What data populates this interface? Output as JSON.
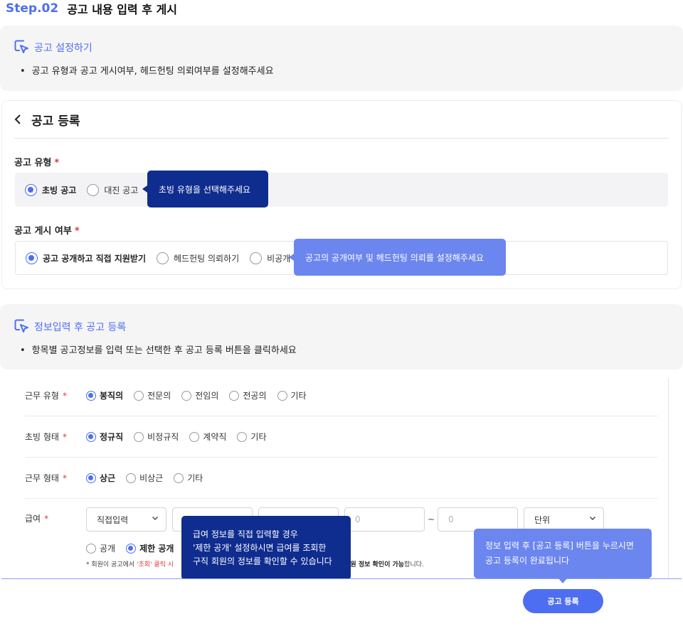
{
  "step": {
    "tag": "Step.02",
    "title": "공고 내용 입력 후 게시"
  },
  "guide1": {
    "title": "공고 설정하기",
    "desc": "공고 유형과 공고 게시여부, 헤드헌팅 의뢰여부를 설정해주세요"
  },
  "register": {
    "back_icon": "chevron-left-icon",
    "title": "공고 등록"
  },
  "job_type": {
    "label": "공고 유형",
    "required": "*",
    "options": [
      {
        "label": "초빙 공고",
        "selected": true
      },
      {
        "label": "대진 공고",
        "selected": false
      }
    ]
  },
  "tip_type": "초빙 유형을 선택해주세요",
  "publish": {
    "label": "공고 게시 여부",
    "required": "*",
    "options": [
      {
        "label": "공고 공개하고 직접 지원받기",
        "selected": true
      },
      {
        "label": "헤드헌팅 의뢰하기",
        "selected": false
      },
      {
        "label": "비공개",
        "selected": false
      }
    ]
  },
  "tip_publish": "공고의 공개여부 및 헤드헌팅 의뢰를 설정해주세요",
  "guide2": {
    "title": "정보입력 후 공고 등록",
    "desc": "항목별 공고정보를 입력 또는 선택한 후 공고 등록 버튼을 클릭하세요"
  },
  "form": {
    "rows": [
      {
        "label": "근무 유형",
        "required": "*",
        "options": [
          {
            "label": "봉직의",
            "selected": true
          },
          {
            "label": "전문의",
            "selected": false
          },
          {
            "label": "전임의",
            "selected": false
          },
          {
            "label": "전공의",
            "selected": false
          },
          {
            "label": "기타",
            "selected": false
          }
        ]
      },
      {
        "label": "초빙 형태",
        "required": "*",
        "options": [
          {
            "label": "정규직",
            "selected": true
          },
          {
            "label": "비정규직",
            "selected": false
          },
          {
            "label": "계약직",
            "selected": false
          },
          {
            "label": "기타",
            "selected": false
          }
        ]
      },
      {
        "label": "근무 형태",
        "required": "*",
        "options": [
          {
            "label": "상근",
            "selected": true
          },
          {
            "label": "비상근",
            "selected": false
          },
          {
            "label": "기타",
            "selected": false
          }
        ]
      }
    ],
    "salary": {
      "label": "급여",
      "required": "*",
      "input_type": "직접입력",
      "min_placeholder": "0",
      "range_sep": "~",
      "max_placeholder": "0",
      "unit": "단위",
      "visibility": [
        {
          "label": "공개",
          "selected": false
        },
        {
          "label": "제한 공개",
          "selected": true
        }
      ],
      "note_prefix": "* 회원이 공고에서 ",
      "note_red": "'조회' 클릭 시",
      "note_bold": "회원 정보 확인이 가능",
      "note_suffix": "합니다."
    }
  },
  "tip_salary": {
    "line1": "급여 정보를 직접 입력할 경우",
    "line2": "'제한 공개' 설정하시면 급여를 조회한",
    "line3": "구직 회원의 정보를 확인할 수 있습니다"
  },
  "tip_submit": {
    "line1": "정보 입력 후 [공고 등록] 버튼을 누르시면",
    "line2": "공고 등록이 완료됩니다"
  },
  "submit_label": "공고 등록",
  "colors": {
    "accent": "#4e6ef2",
    "tooltip_dark": "#0f2c8f",
    "tooltip_light": "#6b86ee",
    "required": "#e23b3b"
  }
}
